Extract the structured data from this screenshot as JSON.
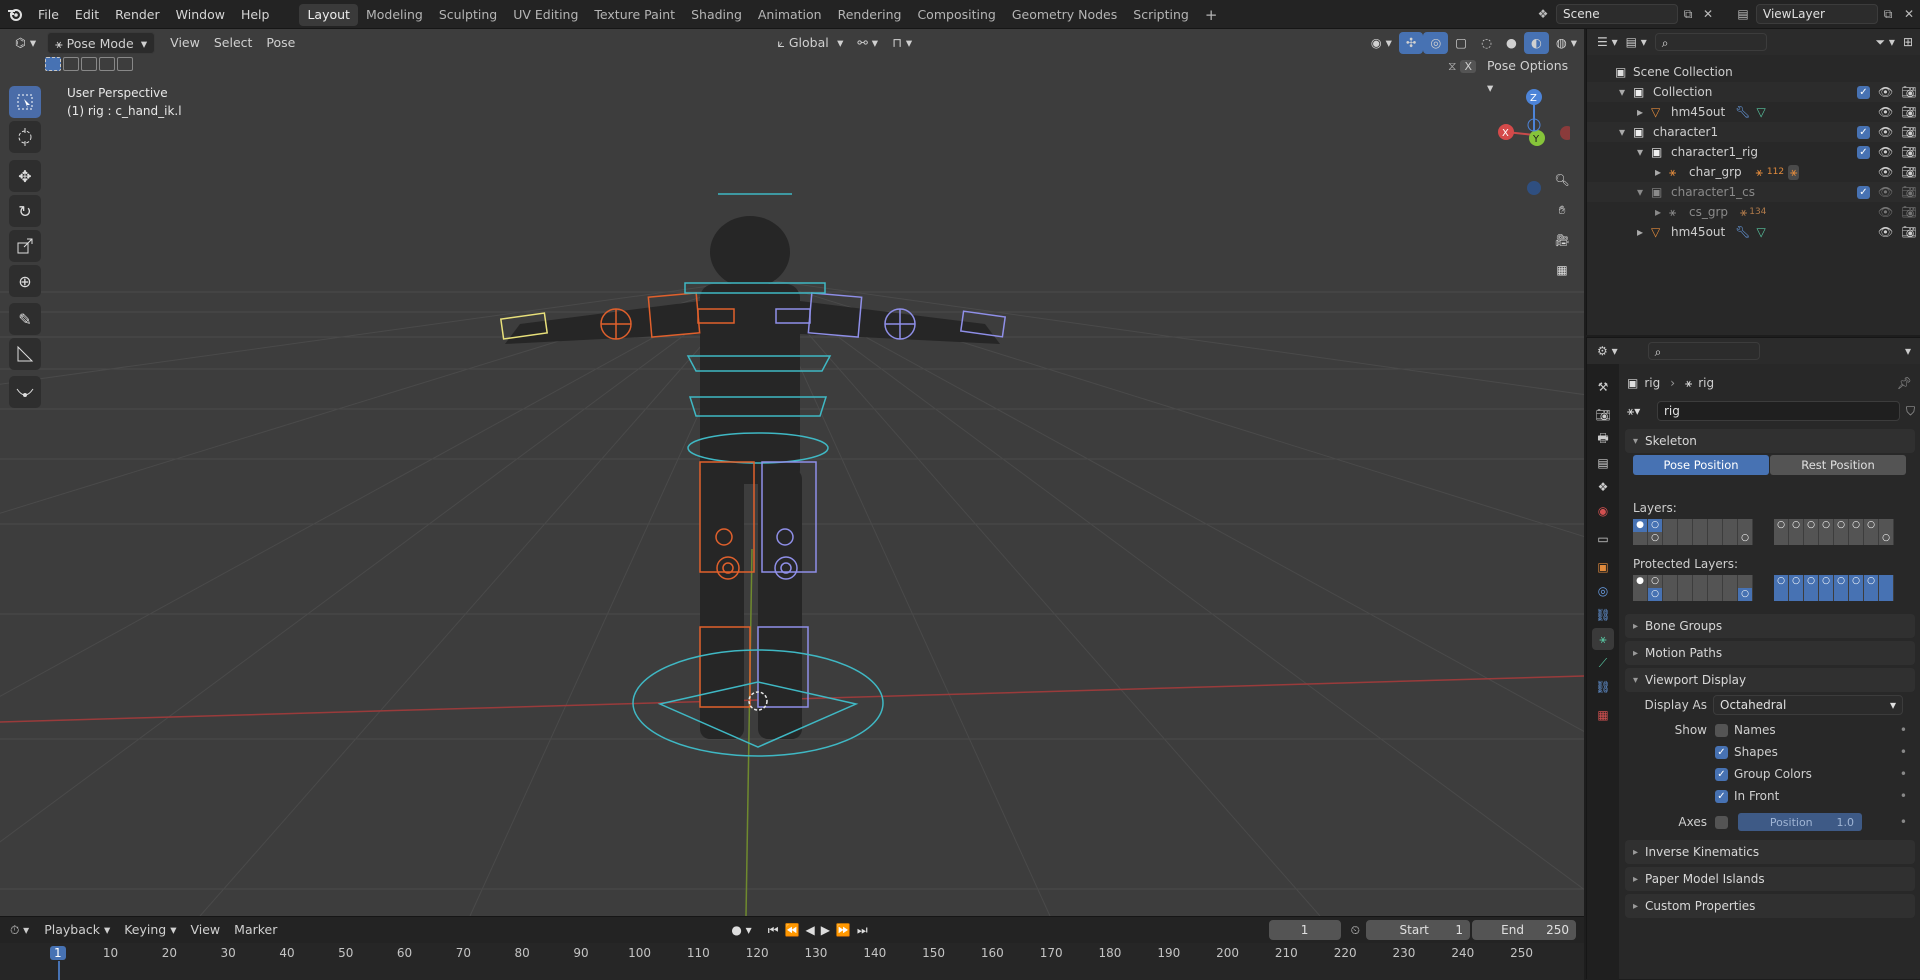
{
  "menus": {
    "file": "File",
    "edit": "Edit",
    "render": "Render",
    "window": "Window",
    "help": "Help"
  },
  "workspaces": [
    "Layout",
    "Modeling",
    "Sculpting",
    "UV Editing",
    "Texture Paint",
    "Shading",
    "Animation",
    "Rendering",
    "Compositing",
    "Geometry Nodes",
    "Scripting"
  ],
  "scene": {
    "name": "Scene",
    "view_layer": "ViewLayer"
  },
  "viewport": {
    "mode": "Pose Mode",
    "menu_view": "View",
    "menu_select": "Select",
    "menu_pose": "Pose",
    "orientation": "Global",
    "pose_options": "Pose Options",
    "perspective": "User Perspective",
    "active_info": "(1) rig : c_hand_ik.l",
    "gizmo": {
      "x": "X",
      "y": "Y",
      "z": "Z"
    }
  },
  "outliner": {
    "scene_collection": "Scene Collection",
    "rows": [
      {
        "label": "Collection"
      },
      {
        "label": "hm45out"
      },
      {
        "label": "character1"
      },
      {
        "label": "character1_rig"
      },
      {
        "label": "char_grp",
        "badge": "112"
      },
      {
        "label": "character1_cs"
      },
      {
        "label": "cs_grp",
        "badge": "134"
      },
      {
        "label": "hm45out"
      }
    ]
  },
  "properties": {
    "breadcrumb_a": "rig",
    "breadcrumb_b": "rig",
    "data_name": "rig",
    "skeleton": "Skeleton",
    "pose_position": "Pose Position",
    "rest_position": "Rest Position",
    "layers": "Layers:",
    "protected_layers": "Protected Layers:",
    "bone_groups": "Bone Groups",
    "motion_paths": "Motion Paths",
    "viewport_display": "Viewport Display",
    "display_as_label": "Display As",
    "display_as_value": "Octahedral",
    "show_label": "Show",
    "names": "Names",
    "shapes": "Shapes",
    "group_colors": "Group Colors",
    "in_front": "In Front",
    "axes_label": "Axes",
    "position_label": "Position",
    "position_value": "1.0",
    "inverse_kinematics": "Inverse Kinematics",
    "paper_model_islands": "Paper Model Islands",
    "custom_properties": "Custom Properties",
    "checks": {
      "names": false,
      "shapes": true,
      "group_colors": true,
      "in_front": true,
      "axes": false
    }
  },
  "timeline": {
    "playback": "Playback",
    "keying": "Keying",
    "view": "View",
    "marker": "Marker",
    "current_frame": "1",
    "start_label": "Start",
    "start": "1",
    "end_label": "End",
    "end": "250",
    "ticks": [
      "1",
      "10",
      "20",
      "30",
      "40",
      "50",
      "60",
      "70",
      "80",
      "90",
      "100",
      "110",
      "120",
      "130",
      "140",
      "150",
      "160",
      "170",
      "180",
      "190",
      "200",
      "210",
      "220",
      "230",
      "240",
      "250"
    ]
  }
}
